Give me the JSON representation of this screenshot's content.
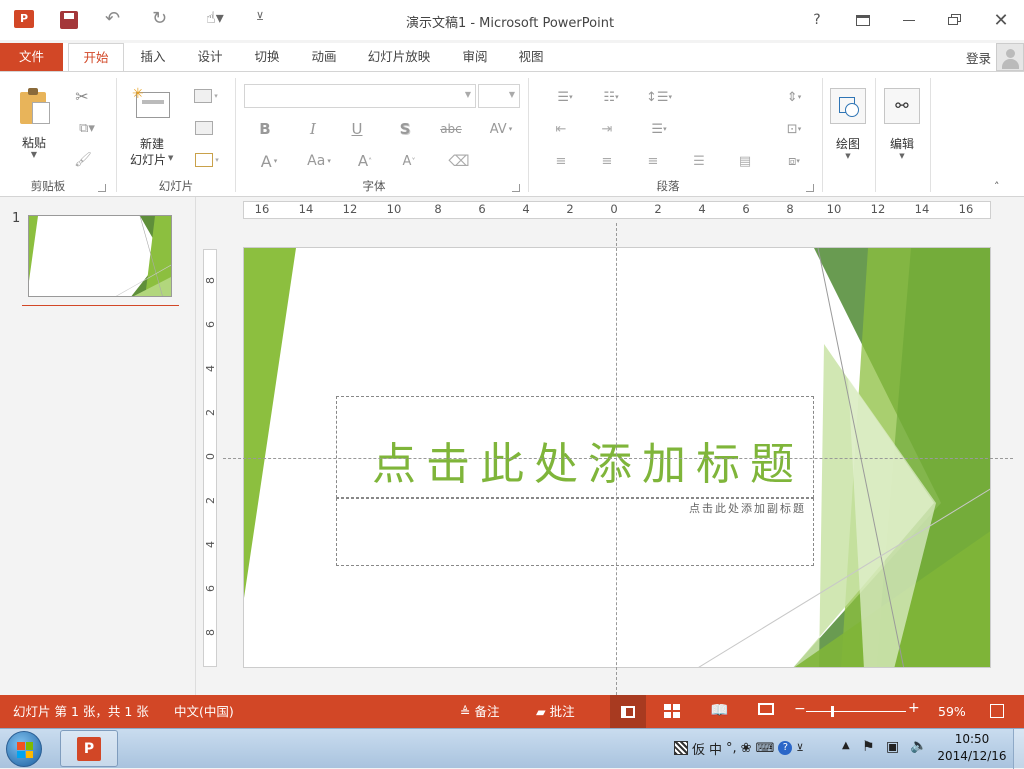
{
  "window": {
    "title": "演示文稿1 - Microsoft PowerPoint",
    "help": "?"
  },
  "tabs": [
    {
      "label": "文件"
    },
    {
      "label": "开始"
    },
    {
      "label": "插入"
    },
    {
      "label": "设计"
    },
    {
      "label": "切换"
    },
    {
      "label": "动画"
    },
    {
      "label": "幻灯片放映"
    },
    {
      "label": "审阅"
    },
    {
      "label": "视图"
    }
  ],
  "account": {
    "signin": "登录"
  },
  "ribbon": {
    "clipboard": {
      "paste": "粘贴",
      "group": "剪贴板"
    },
    "slides": {
      "new_slide_1": "新建",
      "new_slide_2": "幻灯片",
      "group": "幻灯片"
    },
    "font": {
      "group": "字体",
      "bold": "B",
      "italic": "I",
      "underline": "U",
      "shadow": "S",
      "strike": "abc",
      "spacing": "AV",
      "fontcolor": "A",
      "changecase": "Aa",
      "grow": "A",
      "shrink": "A"
    },
    "paragraph": {
      "group": "段落"
    },
    "drawing": {
      "label": "绘图"
    },
    "editing": {
      "label": "编辑"
    }
  },
  "thumbnails": [
    {
      "number": "1"
    }
  ],
  "ruler": {
    "horizontal": [
      "16",
      "14",
      "12",
      "10",
      "8",
      "6",
      "4",
      "2",
      "0",
      "2",
      "4",
      "6",
      "8",
      "10",
      "12",
      "14",
      "16"
    ],
    "vertical": [
      "8",
      "6",
      "4",
      "2",
      "0",
      "2",
      "4",
      "6",
      "8"
    ]
  },
  "slide": {
    "title_placeholder": "点击此处添加标题",
    "subtitle_placeholder": "点击此处添加副标题",
    "accent": "#8cbf3f"
  },
  "status": {
    "slide_info": "幻灯片 第 1 张，共 1 张",
    "language": "中文(中国)",
    "notes": "备注",
    "comments": "批注",
    "zoom": "59%",
    "accent": "#d24726"
  },
  "taskbar": {
    "time": "10:50",
    "date": "2014/12/16",
    "ime": "中"
  }
}
